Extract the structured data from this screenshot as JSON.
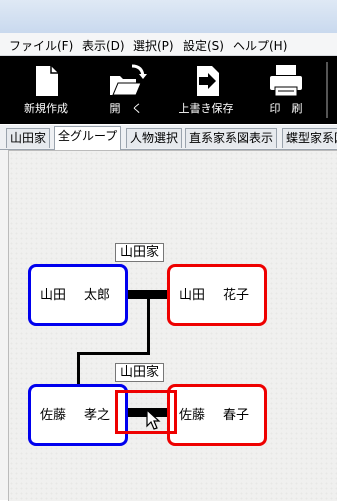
{
  "menu": [
    "ファイル(F)",
    "表示(D)",
    "選択(P)",
    "設定(S)",
    "ヘルプ(H)"
  ],
  "toolbar": {
    "new_label": "新規作成",
    "open_label": "開　く",
    "overwrite_save_label": "上書き保存",
    "print_label": "印　刷"
  },
  "tabs": [
    "山田家",
    "全グループ",
    "人物選択",
    "直系家系図表示",
    "蝶型家系図"
  ],
  "tree": {
    "family1": {
      "label": "山田家"
    },
    "family2": {
      "label": "山田家"
    },
    "persons": {
      "taro": {
        "surname": "山田",
        "given": "太郎",
        "sex": "male"
      },
      "hanako": {
        "surname": "山田",
        "given": "花子",
        "sex": "female"
      },
      "takayuki": {
        "surname": "佐藤",
        "given": "孝之",
        "sex": "male"
      },
      "haruko": {
        "surname": "佐藤",
        "given": "春子",
        "sex": "female"
      }
    }
  },
  "colors": {
    "male": "#0000ee",
    "female": "#ee0000",
    "selection": "#ee0000",
    "toolbar_bg": "#000000"
  },
  "icons": [
    "new-file-icon",
    "open-folder-icon",
    "save-icon",
    "printer-icon"
  ]
}
